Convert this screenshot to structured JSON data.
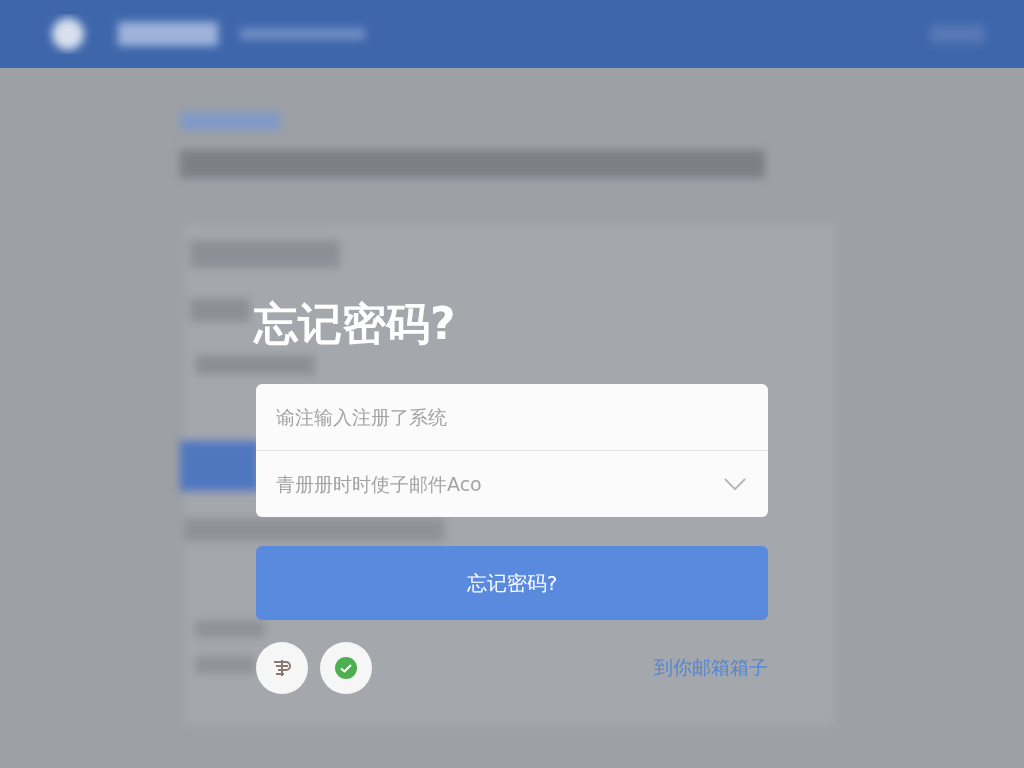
{
  "dialog": {
    "title": "忘记密码?",
    "fields": [
      {
        "kind": "text",
        "placeholder": "谕注输入注册了系统"
      },
      {
        "kind": "dropdown",
        "placeholder": "青册册时时使子邮件Aco"
      }
    ],
    "submit": {
      "label": "忘记密码?"
    },
    "social": [
      {
        "kind": "emblem"
      },
      {
        "kind": "check"
      }
    ],
    "link": "到你邮箱箱子"
  }
}
